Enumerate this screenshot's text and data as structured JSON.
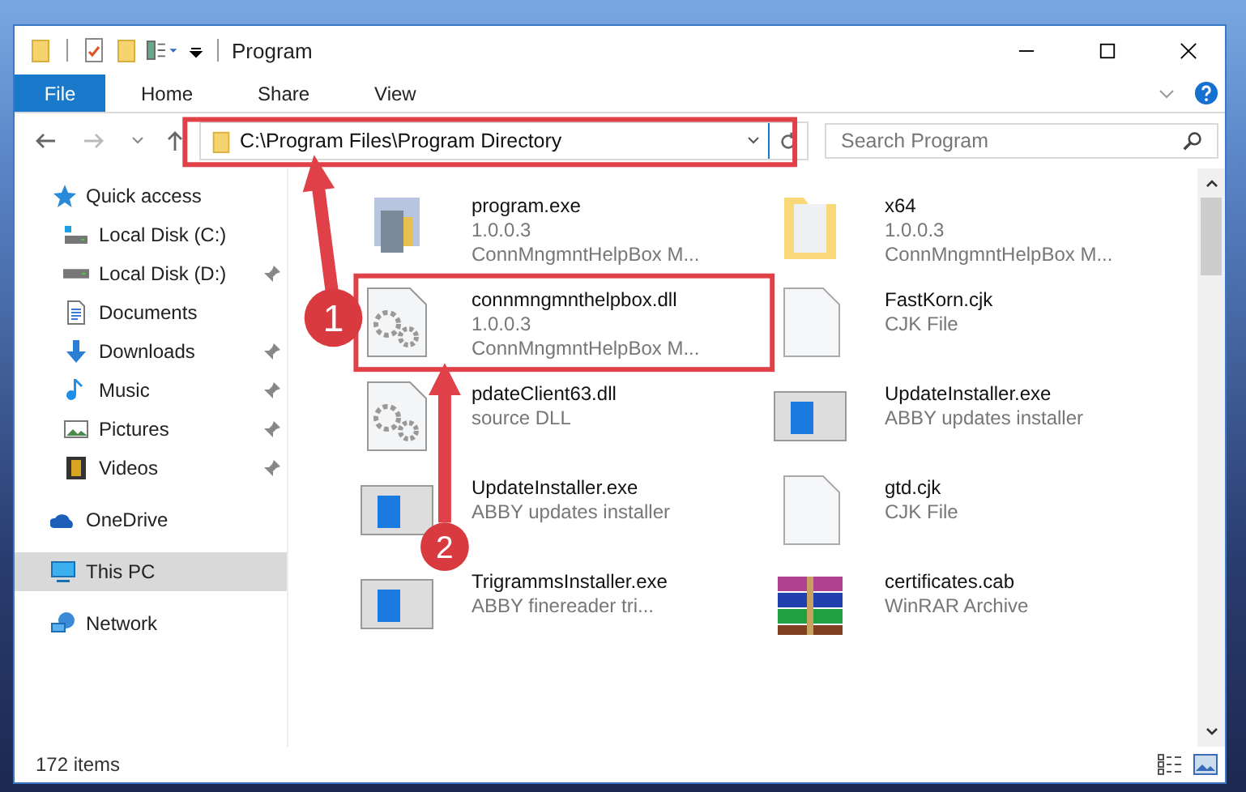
{
  "window": {
    "title": "Program"
  },
  "ribbon_tabs": [
    {
      "label": "File",
      "selected": true
    },
    {
      "label": "Home",
      "selected": false
    },
    {
      "label": "Share",
      "selected": false
    },
    {
      "label": "View",
      "selected": false
    }
  ],
  "address_bar": {
    "path": "C:\\Program Files\\Program Directory"
  },
  "search": {
    "placeholder": "Search Program"
  },
  "sidebar": {
    "items": [
      {
        "label": "Quick access",
        "kind": "star",
        "pinned": false,
        "selected": false,
        "children": [
          {
            "label": "Local Disk (C:)",
            "kind": "drive-c",
            "pinned": false,
            "selected": false
          },
          {
            "label": "Local Disk (D:)",
            "kind": "drive",
            "pinned": true,
            "selected": false
          },
          {
            "label": "Documents",
            "kind": "documents",
            "pinned": false,
            "selected": false
          },
          {
            "label": "Downloads",
            "kind": "downloads",
            "pinned": true,
            "selected": false
          },
          {
            "label": "Music",
            "kind": "music",
            "pinned": true,
            "selected": false
          },
          {
            "label": "Pictures",
            "kind": "pictures",
            "pinned": true,
            "selected": false
          },
          {
            "label": "Videos",
            "kind": "videos",
            "pinned": true,
            "selected": false
          }
        ]
      },
      {
        "label": "OneDrive",
        "kind": "cloud",
        "pinned": false,
        "selected": false
      },
      {
        "label": "This PC",
        "kind": "pc",
        "pinned": false,
        "selected": true
      },
      {
        "label": "Network",
        "kind": "network",
        "pinned": false,
        "selected": false
      }
    ]
  },
  "files": [
    {
      "name": "program.exe",
      "details": [
        "1.0.0.3",
        "ConnMngmntHelpBox M..."
      ],
      "kind": "app"
    },
    {
      "name": "x64",
      "details": [
        "1.0.0.3",
        "ConnMngmntHelpBox M..."
      ],
      "kind": "folder"
    },
    {
      "name": "connmngmnthelpbox.dll",
      "details": [
        "1.0.0.3",
        "ConnMngmntHelpBox M..."
      ],
      "kind": "dll"
    },
    {
      "name": "FastKorn.cjk",
      "details": [
        "CJK File"
      ],
      "kind": "document"
    },
    {
      "name": "pdateClient63.dll",
      "details": [
        "source DLL"
      ],
      "kind": "dll"
    },
    {
      "name": "UpdateInstaller.exe",
      "details": [
        "ABBY updates installer"
      ],
      "kind": "installer"
    },
    {
      "name": "UpdateInstaller.exe",
      "details": [
        "ABBY updates installer"
      ],
      "kind": "installer"
    },
    {
      "name": "gtd.cjk",
      "details": [
        "CJK File"
      ],
      "kind": "document"
    },
    {
      "name": "TrigrammsInstaller.exe",
      "details": [
        "ABBY finereader tri..."
      ],
      "kind": "installer"
    },
    {
      "name": "certificates.cab",
      "details": [
        "WinRAR Archive"
      ],
      "kind": "archive"
    }
  ],
  "status_bar": {
    "item_count": "172 items"
  },
  "annotations": [
    {
      "kind": "step",
      "label": "1"
    },
    {
      "kind": "step",
      "label": "2"
    }
  ]
}
